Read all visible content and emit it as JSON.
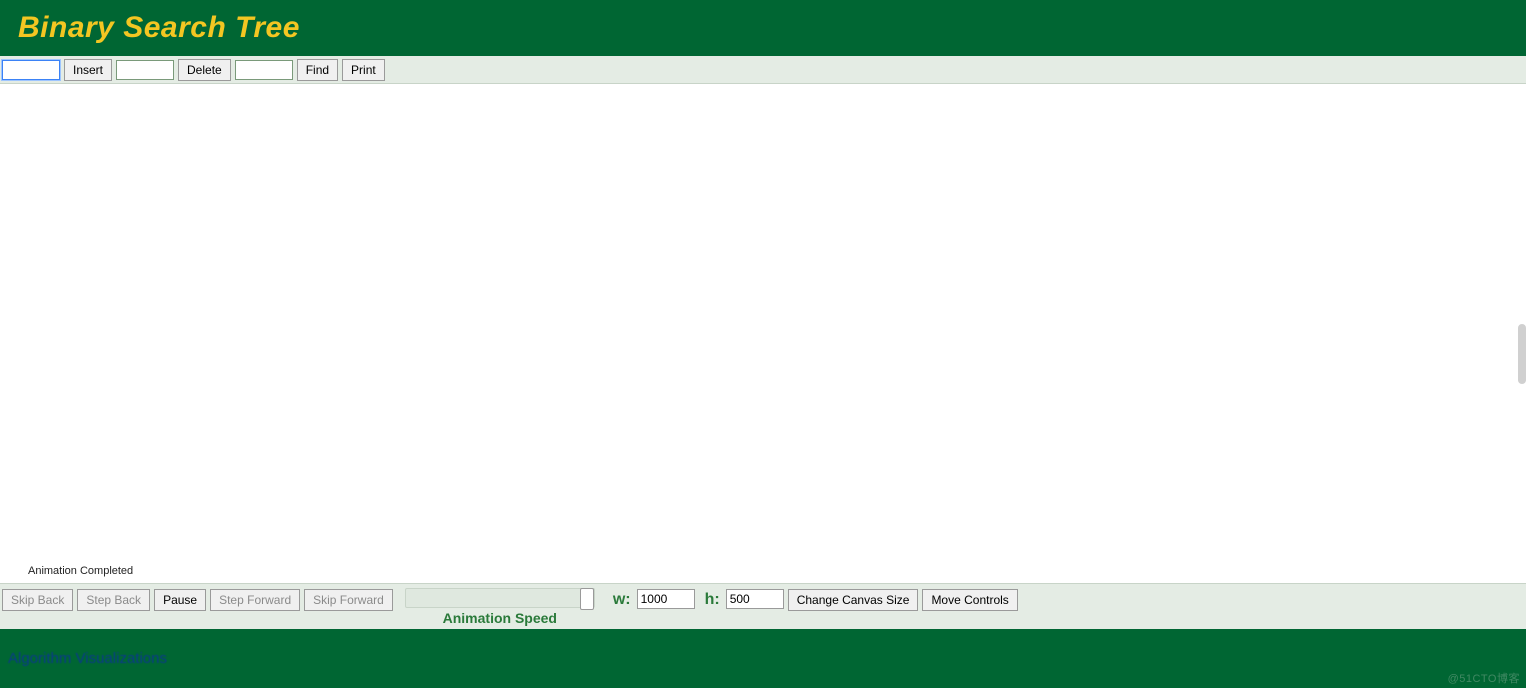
{
  "header": {
    "title": "Binary Search Tree"
  },
  "toolbar": {
    "insert": {
      "value": "",
      "label": "Insert"
    },
    "delete": {
      "value": "",
      "label": "Delete"
    },
    "find": {
      "value": "",
      "label": "Find"
    },
    "print": {
      "label": "Print"
    }
  },
  "canvas": {
    "status": "Animation Completed"
  },
  "controls": {
    "skip_back": "Skip Back",
    "step_back": "Step Back",
    "pause": "Pause",
    "step_forward": "Step Forward",
    "skip_forward": "Skip Forward",
    "speed_label": "Animation Speed",
    "w_label": "w:",
    "h_label": "h:",
    "width": "1000",
    "height": "500",
    "change_canvas": "Change Canvas Size",
    "move_controls": "Move Controls"
  },
  "footer": {
    "link_text": "Algorithm Visualizations",
    "watermark": "@51CTO博客"
  }
}
